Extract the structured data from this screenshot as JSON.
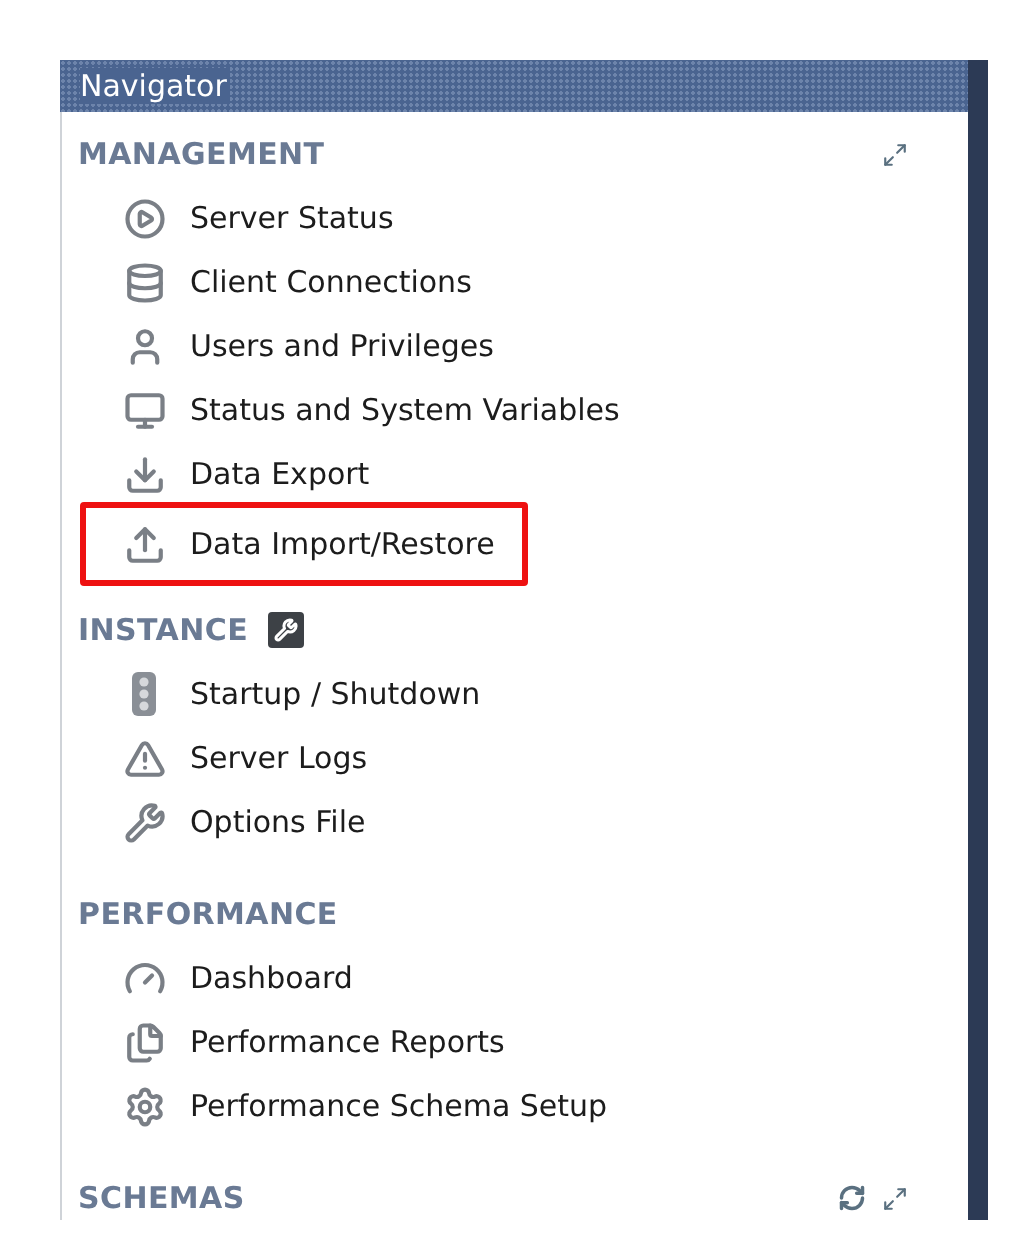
{
  "panel": {
    "title": "Navigator"
  },
  "sections": [
    {
      "title": "MANAGEMENT",
      "items": [
        {
          "label": "Server Status",
          "highlighted": false
        },
        {
          "label": "Client Connections",
          "highlighted": false
        },
        {
          "label": "Users and Privileges",
          "highlighted": false
        },
        {
          "label": "Status and System Variables",
          "highlighted": false
        },
        {
          "label": "Data Export",
          "highlighted": false
        },
        {
          "label": "Data Import/Restore",
          "highlighted": true
        }
      ]
    },
    {
      "title": "INSTANCE",
      "items": [
        {
          "label": "Startup / Shutdown",
          "highlighted": false
        },
        {
          "label": "Server Logs",
          "highlighted": false
        },
        {
          "label": "Options File",
          "highlighted": false
        }
      ]
    },
    {
      "title": "PERFORMANCE",
      "items": [
        {
          "label": "Dashboard",
          "highlighted": false
        },
        {
          "label": "Performance Reports",
          "highlighted": false
        },
        {
          "label": "Performance Schema Setup",
          "highlighted": false
        }
      ]
    },
    {
      "title": "SCHEMAS"
    }
  ]
}
